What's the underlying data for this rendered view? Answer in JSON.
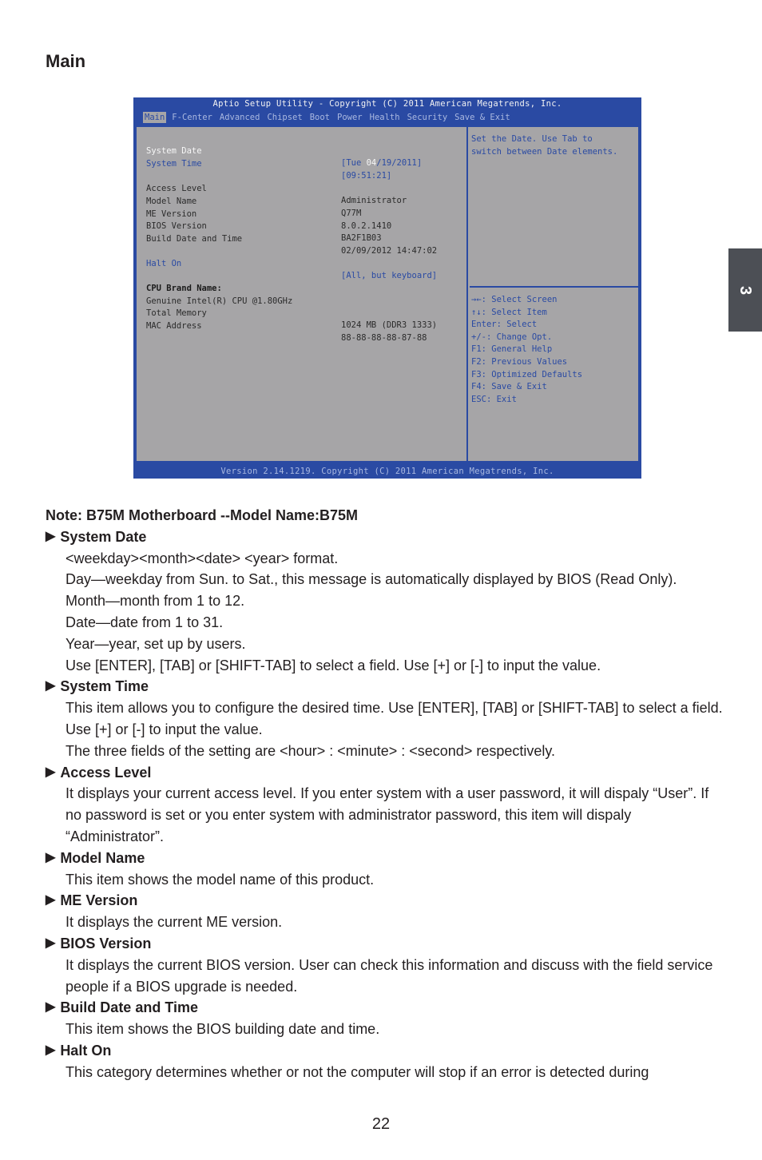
{
  "page": {
    "title": "Main",
    "chapter_tab": "3",
    "page_number": "22"
  },
  "bios": {
    "title": "Aptio Setup Utility - Copyright (C) 2011 American Megatrends, Inc.",
    "menu": [
      "Main",
      "F-Center",
      "Advanced",
      "Chipset",
      "Boot",
      "Power",
      "Health",
      "Security",
      "Save & Exit"
    ],
    "active_menu": "Main",
    "items": [
      {
        "label": "System Date",
        "value_pre": "[Tue ",
        "value_hl": "04",
        "value_post": "/19/2011]"
      },
      {
        "label": "System Time",
        "value": "[09:51:21]"
      },
      {
        "label": "Access Level",
        "value": "Administrator"
      },
      {
        "label": "Model Name",
        "value": "Q77M"
      },
      {
        "label": "ME Version",
        "value": "8.0.2.1410"
      },
      {
        "label": "BIOS Version",
        "value": "BA2F1B03"
      },
      {
        "label": "Build Date and Time",
        "value": "02/09/2012 14:47:02"
      },
      {
        "label": "Halt On",
        "value": "[All, but keyboard]"
      },
      {
        "label": "CPU Brand Name:"
      },
      {
        "label": "Genuine Intel(R) CPU @1.80GHz"
      },
      {
        "label": "Total Memory",
        "value": "1024 MB (DDR3 1333)"
      },
      {
        "label": "MAC Address",
        "value": "88-88-88-88-87-88"
      }
    ],
    "help_text": [
      "Set the Date. Use Tab to",
      "switch between Date elements."
    ],
    "key_help": [
      "→←: Select Screen",
      "↑↓: Select Item",
      "Enter: Select",
      "+/-: Change Opt.",
      "F1: General Help",
      "F2: Previous Values",
      "F3: Optimized Defaults",
      "F4: Save & Exit",
      "ESC: Exit"
    ],
    "footer": "Version 2.14.1219. Copyright (C) 2011 American Megatrends, Inc."
  },
  "doc": {
    "note": "Note: B75M Motherboard --Model Name:B75M",
    "sections": [
      {
        "heading": "System Date",
        "lines": [
          "<weekday><month><date> <year> format.",
          "Day—weekday from Sun. to Sat., this message is automatically displayed by BIOS (Read Only).",
          "Month—month from 1 to 12.",
          "Date—date from 1 to 31.",
          "Year—year, set up by users.",
          "Use [ENTER], [TAB] or [SHIFT-TAB] to select a field. Use [+] or [-] to input the value."
        ]
      },
      {
        "heading": "System Time",
        "lines": [
          "This item allows you to configure the desired time. Use [ENTER], [TAB] or [SHIFT-TAB] to select a field. Use [+] or [-] to input the value.",
          "The three fields of the setting are <hour> : <minute> : <second> respectively."
        ]
      },
      {
        "heading": "Access Level",
        "lines": [
          "It displays your current access level. If you enter system with a user password, it will dispaly “User”. If no password is set or you enter system with administrator password, this item will dispaly “Administrator”."
        ]
      },
      {
        "heading": "Model Name",
        "lines": [
          "This item shows the model name of this product."
        ]
      },
      {
        "heading": "ME Version",
        "lines": [
          "It displays the current ME version."
        ]
      },
      {
        "heading": "BIOS Version",
        "lines": [
          "It displays the current BIOS version. User can check this information and discuss with the field service people if a BIOS upgrade is needed."
        ]
      },
      {
        "heading": "Build Date and Time",
        "lines": [
          "This item shows the BIOS building date and time."
        ]
      },
      {
        "heading": "Halt On",
        "lines": [
          "This category determines whether or not the computer will stop if an error is detected during"
        ]
      }
    ]
  }
}
